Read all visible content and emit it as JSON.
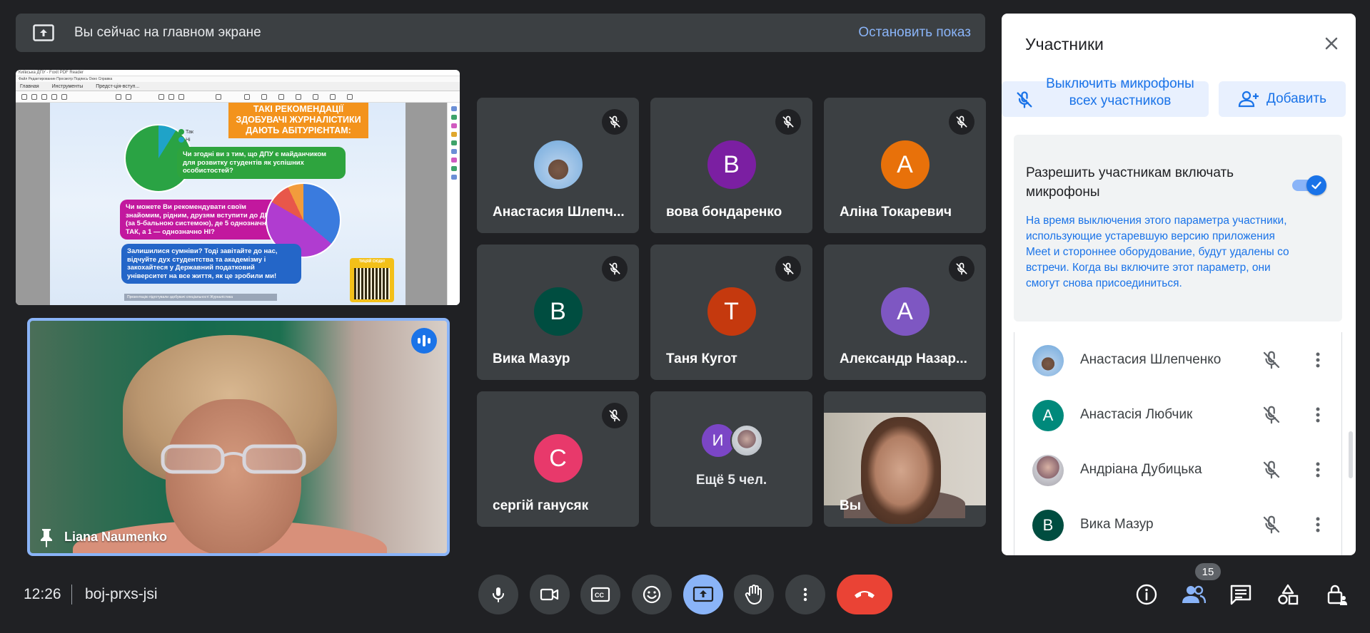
{
  "banner": {
    "message": "Вы сейчас на главном экране",
    "stop_label": "Остановить показ"
  },
  "shared_screen": {
    "window_title": "Київська ДПУ - Foxit PDF Reader",
    "menu": "Файл  Редактирование  Просмотр  Подпись  Окно  Справка",
    "tabs": [
      "Главная",
      "Инструменты",
      "Предст-ція-вступ..."
    ],
    "poster": {
      "header": "ТАКІ РЕКОМЕНДАЦІЇ ЗДОБУВАЧІ ЖУРНАЛІСТИКИ ДАЮТЬ АБІТУРІЄНТАМ:",
      "legend": [
        "Так",
        "Ні"
      ],
      "q1": "Чи згодні ви з тим, що ДПУ є майданчиком для розвитку студентів як успішних особистостей?",
      "q2": "Чи можете Ви рекомендувати своїм знайомим, рідним, друзям вступити до ДПУ (за 5-бальною системою), де 5 однозначно ТАК, а 1 — однозначно НІ?",
      "q3": "Залишилися сумніви? Тоді завітайте до нас, відчуйте дух студентства та академізму і закохайтеся у Державний податковий університет на все життя, як це зробили ми!",
      "qr_label": "ТИЦЯЙ СЮДИ!",
      "footer": "Презентацію підготували здобувачі спеціальності Журналістика"
    }
  },
  "speaker": {
    "name": "Liana Naumenko"
  },
  "tiles": [
    {
      "name": "Анастасия Шлепч...",
      "avatar": "",
      "color": "#6fa8dc",
      "photo": true
    },
    {
      "name": "вова бондаренко",
      "avatar": "B",
      "color": "#7b1fa2"
    },
    {
      "name": "Аліна Токаревич",
      "avatar": "A",
      "color": "#e8710a"
    },
    {
      "name": "Вика Мазур",
      "avatar": "B",
      "color": "#004d40"
    },
    {
      "name": "Таня Кугот",
      "avatar": "T",
      "color": "#c5390e"
    },
    {
      "name": "Александр Назар...",
      "avatar": "A",
      "color": "#7e57c2"
    },
    {
      "name": "сергій ганусяк",
      "avatar": "C",
      "color": "#e8396b"
    }
  ],
  "more_tile": {
    "avatar": "И",
    "label": "Ещё 5 чел."
  },
  "self_tile": {
    "name": "Вы"
  },
  "panel": {
    "title": "Участники",
    "mute_all_label": "Выключить микрофоны всех участников",
    "add_label": "Добавить",
    "setting_title": "Разрешить участникам включать микрофоны",
    "setting_desc": "На время выключения этого параметра участники, использующие устаревшую версию приложения Meet и стороннее оборудование, будут удалены со встречи. Когда вы включите этот параметр, они смогут снова присоединиться.",
    "setting_enabled": true,
    "participants": [
      {
        "name": "Анастасия Шлепченко",
        "avatar": "",
        "color": "#6fa8dc",
        "photo": true
      },
      {
        "name": "Анастасія Любчик",
        "avatar": "A",
        "color": "#00897b"
      },
      {
        "name": "Андріана Дубицька",
        "avatar": "",
        "color": "#a08a8e",
        "photo": true
      },
      {
        "name": "Вика Мазур",
        "avatar": "B",
        "color": "#004d40"
      }
    ]
  },
  "bottom": {
    "time": "12:26",
    "meeting_code": "boj-prxs-jsi",
    "participants_count": "15"
  },
  "colors": {
    "accent": "#8ab4f8",
    "blue": "#1a73e8",
    "leave": "#ea4335",
    "surface": "#3c4043",
    "background": "#202124"
  }
}
